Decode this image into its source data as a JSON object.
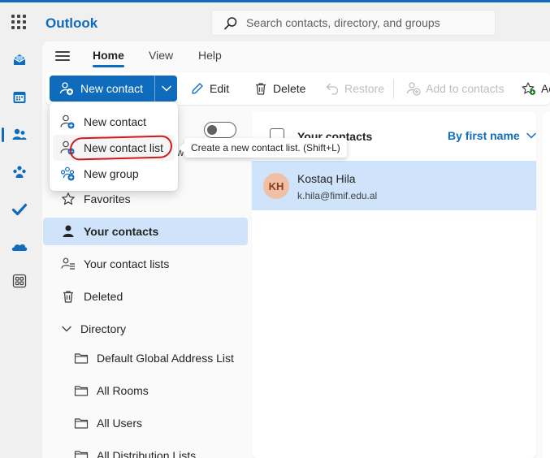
{
  "app": {
    "title": "Outlook",
    "search_placeholder": "Search contacts, directory, and groups"
  },
  "rail": {
    "items": [
      {
        "name": "mail"
      },
      {
        "name": "calendar"
      },
      {
        "name": "people",
        "active": true
      },
      {
        "name": "groups"
      },
      {
        "name": "to-do"
      },
      {
        "name": "onedrive"
      },
      {
        "name": "more-apps"
      }
    ]
  },
  "tabs": [
    {
      "label": "Home",
      "active": true
    },
    {
      "label": "View"
    },
    {
      "label": "Help"
    }
  ],
  "toolbar": {
    "new_contact": "New contact",
    "edit": "Edit",
    "delete": "Delete",
    "restore": "Restore",
    "add_to_contacts": "Add to contacts",
    "overflow": "Ac"
  },
  "dropdown": {
    "items": [
      {
        "label": "New contact"
      },
      {
        "label": "New contact list"
      },
      {
        "label": "New group"
      }
    ]
  },
  "tooltip": "Create a new contact list. (Shift+L)",
  "nav": {
    "peek_char": "w",
    "favorites": "Favorites",
    "your_contacts": "Your contacts",
    "your_contact_lists": "Your contact lists",
    "deleted": "Deleted",
    "directory": "Directory",
    "directory_items": [
      "Default Global Address List",
      "All Rooms",
      "All Users",
      "All Distribution Lists"
    ]
  },
  "list": {
    "title": "Your contacts",
    "sort": "By first name",
    "contacts": [
      {
        "initials": "KH",
        "name": "Kostaq Hila",
        "email": "k.hila@fimif.edu.al"
      }
    ]
  },
  "colors": {
    "accent": "#0f6cbd",
    "selected_bg": "#cfe4fa",
    "annotation_red": "#d21a1a",
    "avatar_bg": "#f1bfa6"
  }
}
